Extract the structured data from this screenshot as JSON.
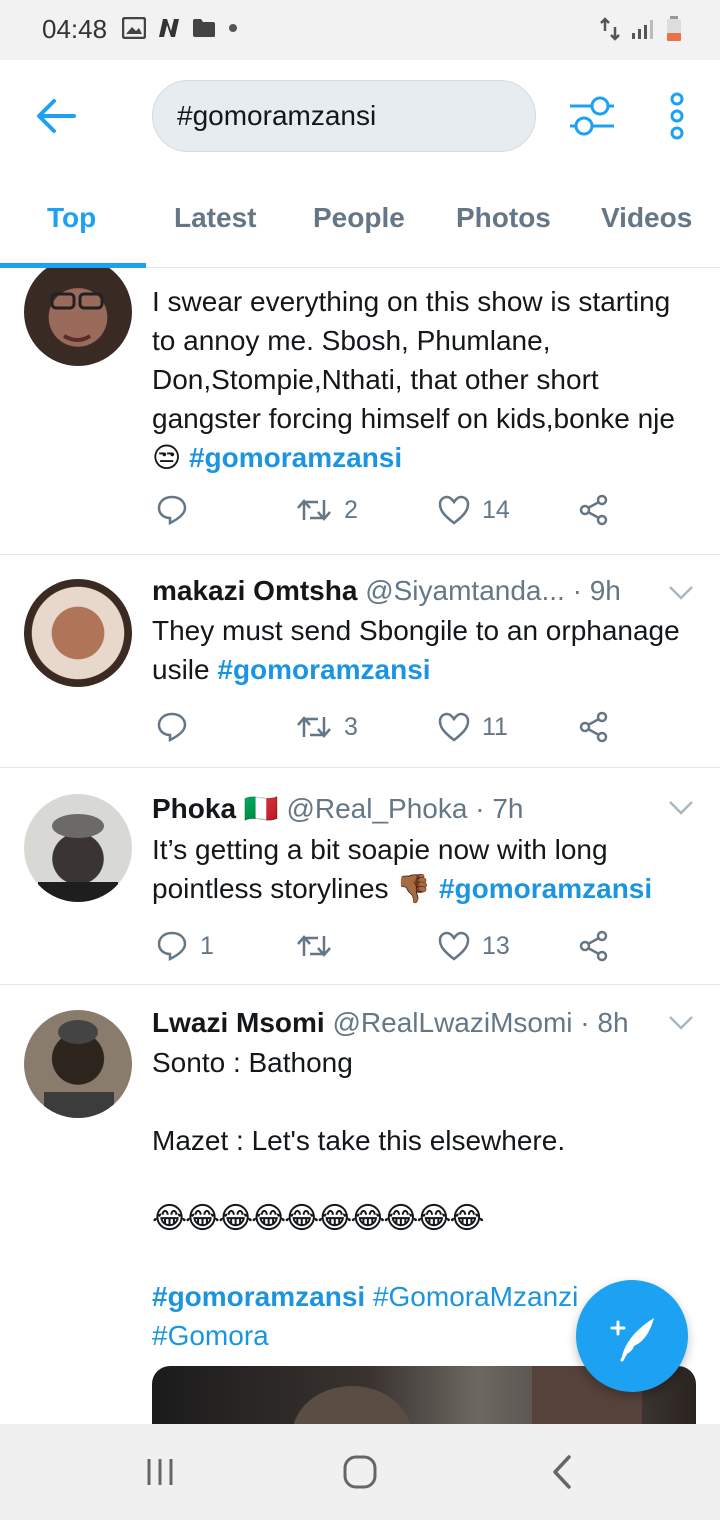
{
  "status": {
    "time": "04:48"
  },
  "search": {
    "query": "#gomoramzansi"
  },
  "tabs": [
    {
      "label": "Top"
    },
    {
      "label": "Latest"
    },
    {
      "label": "People"
    },
    {
      "label": "Photos"
    },
    {
      "label": "Videos"
    }
  ],
  "colors": {
    "accent": "#1da1f2",
    "hashtag": "#1b95e0",
    "secondary": "#657786"
  },
  "tweets": [
    {
      "text": "I swear everything on this show is starting to annoy me. Sbosh, Phumlane, Don,Stompie,Nthati, that other short gangster forcing himself on kids,bonke nje 😒",
      "hashtag": "#gomoramzansi",
      "replies": "",
      "retweets": "2",
      "likes": "14"
    },
    {
      "name": "makazi Omtsha",
      "handle": "@Siyamtanda...",
      "time": "· 9h",
      "text": "They must send Sbongile to an orphanage usile",
      "hashtag": "#gomoramzansi",
      "replies": "",
      "retweets": "3",
      "likes": "11"
    },
    {
      "name": "Phoka",
      "flag": "🇮🇹",
      "handle": "@Real_Phoka · 7h",
      "text": "It’s getting a bit soapie now with long pointless storylines 👎🏾",
      "hashtag": "#gomoramzansi",
      "replies": "1",
      "retweets": "",
      "likes": "13"
    },
    {
      "name": "Lwazi Msomi",
      "handle": "@RealLwaziMsomi · 8h",
      "line1": "Sonto : Bathong",
      "line2": "Mazet : Let's take this elsewhere.",
      "emojis": "😂😂😂😂😂😂😂😂😂😂",
      "hashtag": "#gomoramzansi",
      "hashtag2": "#GomoraMzanzi",
      "hashtag3": "#Gomora"
    }
  ]
}
